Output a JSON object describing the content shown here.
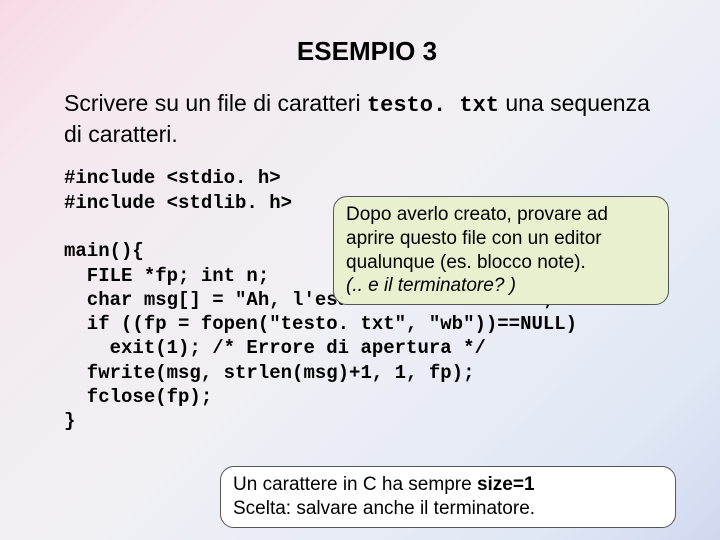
{
  "title": "ESEMPIO 3",
  "intro": {
    "part1": "Scrivere su un file di caratteri ",
    "filename": "testo. txt",
    "part2": " una sequenza di caratteri."
  },
  "code": {
    "l1": "#include <stdio. h>",
    "l2": "#include <stdlib. h>",
    "l3": "",
    "l4": "main(){",
    "l5": "  FILE *fp; int n;",
    "l6": "  char msg[] = \"Ah, l'esame\\nsi avvicina!\";",
    "l7": "  if ((fp = fopen(\"testo. txt\", \"wb\"))==NULL)",
    "l8": "    exit(1); /* Errore di apertura */",
    "l9": "  fwrite(msg, strlen(msg)+1, 1, fp);",
    "l10": "  fclose(fp);",
    "l11": "}"
  },
  "callout1": {
    "line1": "Dopo averlo creato, provare ad",
    "line2": "aprire questo file con un editor",
    "line3": "qualunque (es. blocco note).",
    "line4a": "(.. e il terminatore? )"
  },
  "callout2": {
    "line1a": "Un carattere in C ha sempre ",
    "line1b": "size=1",
    "line2": "Scelta: salvare anche il terminatore."
  }
}
